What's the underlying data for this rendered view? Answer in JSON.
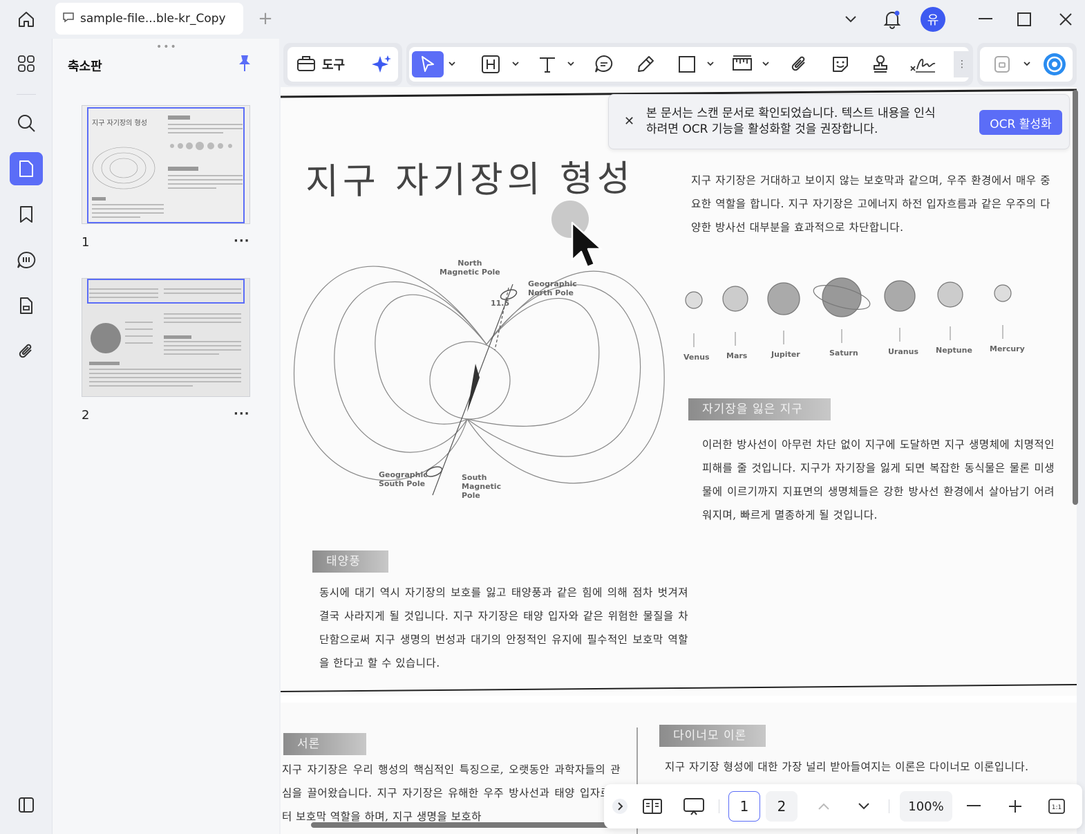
{
  "titlebar": {
    "tab_title": "sample-file...ble-kr_Copy",
    "avatar_label": "유"
  },
  "sidebar": {
    "panel_title": "축소판",
    "pages": [
      {
        "number": "1"
      },
      {
        "number": "2"
      }
    ],
    "more_label": "···"
  },
  "toolbar": {
    "tools_label": "도구"
  },
  "ocr_banner": {
    "message": "본 문서는 스캔 문서로 확인되었습니다. 텍스트 내용을 인식하려면 OCR 기능을 활성화할 것을 권장합니다.",
    "button": "OCR 활성화"
  },
  "document": {
    "title": "지구 자기장의 형성",
    "intro": "지구 자기장은 거대하고 보이지 않는 보호막과 같으며, 우주 환경에서 매우 중요한 역할을 합니다. 지구 자기장은 고에너지 하전 입자흐름과 같은 우주의 다양한 방사선 대부분을 효과적으로 차단합니다.",
    "diagram_labels": {
      "north_magnetic": "North\nMagnetic Pole",
      "geographic_north": "Geographic\nNorth Pole",
      "angle": "11.5",
      "geographic_south": "Geographic\nSouth Pole",
      "south_magnetic": "South\nMagnetic\nPole"
    },
    "planets": [
      "Venus",
      "Mars",
      "Jupiter",
      "Saturn",
      "Uranus",
      "Neptune",
      "Mercury"
    ],
    "section_lost": {
      "heading": "자기장을 잃은 지구",
      "text": "이러한 방사선이 아무런 차단 없이 지구에 도달하면 지구 생명체에 치명적인 피해를 줄 것입니다. 지구가 자기장을 잃게 되면 복잡한 동식물은 물론 미생물에 이르기까지 지표면의 생명체들은 강한 방사선 환경에서 살아남기 어려워지며, 빠르게 멸종하게 될 것입니다."
    },
    "section_wind": {
      "heading": "태양풍",
      "text": "동시에 대기 역시 자기장의 보호를 잃고 태양풍과 같은 힘에 의해 점차 벗겨져 결국 사라지게 될 것입니다. 지구 자기장은 태양 입자와 같은 위험한 물질을 차단함으로써 지구 생명의 번성과 대기의 안정적인 유지에 필수적인 보호막 역할을 한다고 할 수 있습니다."
    },
    "page2": {
      "intro_heading": "서론",
      "intro_text": "지구 자기장은 우리 행성의 핵심적인 특징으로, 오랫동안 과학자들의 관심을 끌어왔습니다. 지구 자기장은 유해한 우주 방사선과 태양 입자로부터 보호막 역할을 하며, 지구 생명을 보호하",
      "dynamo_heading": "다이너모 이론",
      "dynamo_text": "지구 자기장 형성에 대한 가장 널리 받아들여지는 이론은 다이너모 이론입니다."
    }
  },
  "bottom_nav": {
    "page_1": "1",
    "page_2": "2",
    "zoom": "100%"
  },
  "colors": {
    "accent": "#5b6df7",
    "avatar": "#3d5af1"
  }
}
